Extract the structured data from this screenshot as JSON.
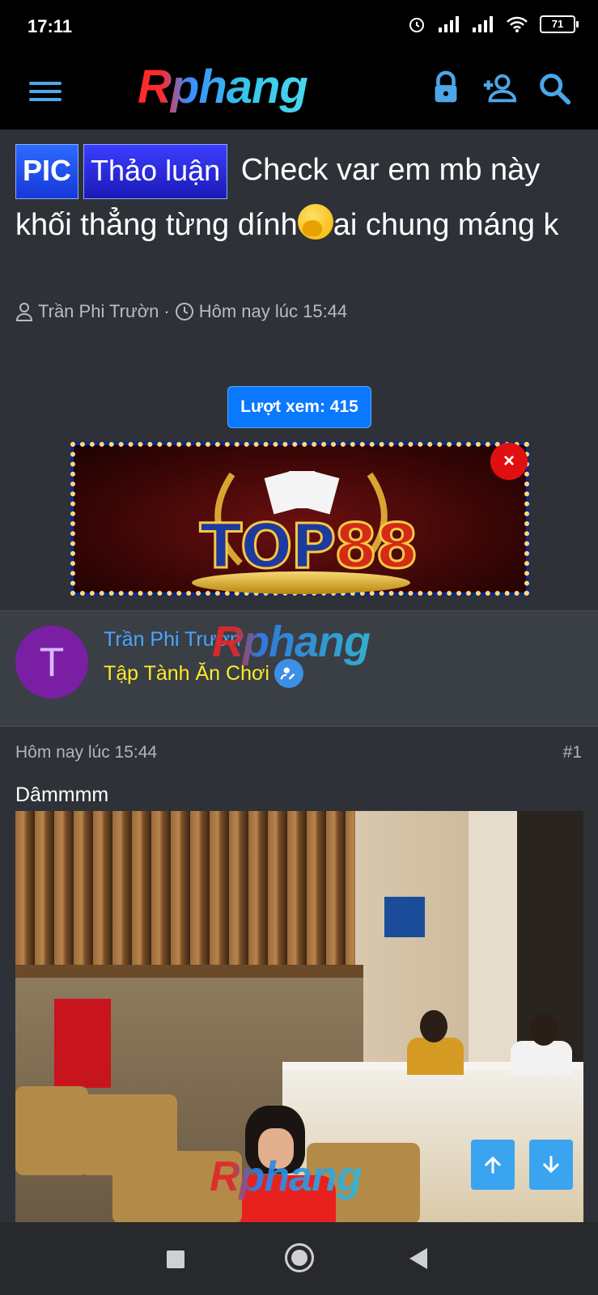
{
  "status_bar": {
    "time": "17:11",
    "battery": "71"
  },
  "header": {
    "logo": "Rphang"
  },
  "thread": {
    "prefix_pic": "PIC",
    "prefix_discussion": "Thảo luận",
    "title_part1": "Check var em mb này khối thẳng từng dính",
    "title_part2": "ai chung máng k",
    "author": "Trần Phi Trườn",
    "time": "Hôm nay lúc 15:44",
    "views": "Lượt xem: 415"
  },
  "ad": {
    "brand_top": "TOP",
    "brand_num": "88",
    "close": "×"
  },
  "user": {
    "avatar_letter": "T",
    "name": "Trần Phi Trườn",
    "rank": "Tập Tành Ăn Chơi",
    "watermark": "Rphang"
  },
  "post": {
    "date": "Hôm nay lúc 15:44",
    "number": "#1",
    "text": "Dâmmmm",
    "watermark": "Rphang"
  },
  "colors": {
    "accent": "#4da6e8",
    "username": "#4aa6ff",
    "rank": "#ffea2a",
    "background": "#2e3137"
  }
}
